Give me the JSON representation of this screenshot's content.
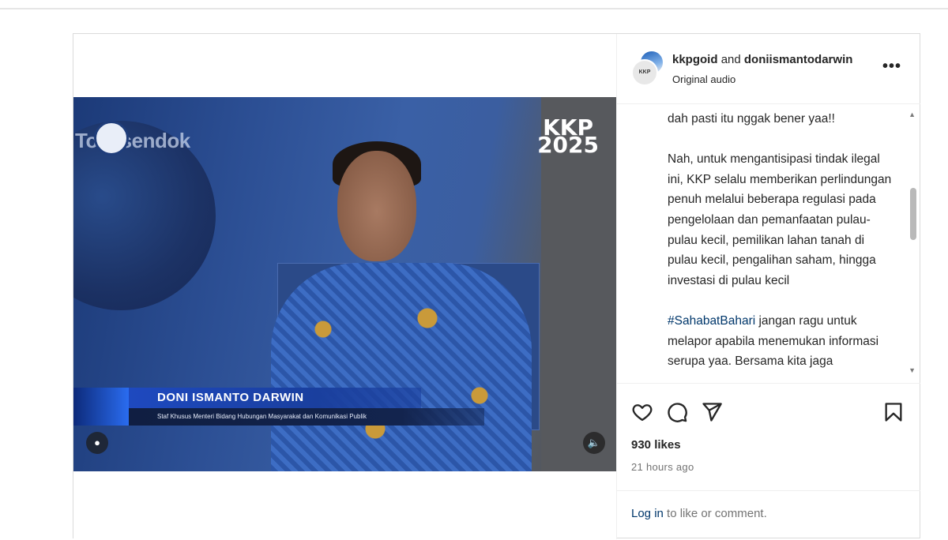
{
  "post": {
    "accounts": {
      "primary": "kkpgoid",
      "connector": "and",
      "secondary": "doniismantodarwin",
      "avatar_text": "KKP"
    },
    "audio_label": "Original audio",
    "more_label": "•••",
    "video": {
      "brand_text": "Tol gsendok",
      "logo_text_line1": "KKP",
      "logo_text_line2": "2025",
      "lower_third_name": "DONI ISMANTO DARWIN",
      "lower_third_title": "Staf Khusus Menteri Bidang Hubungan Masyarakat dan Komunikasi Publik"
    },
    "caption": {
      "line_top": "dah pasti itu nggak bener yaa!!",
      "paragraph2": "Nah, untuk mengantisipasi tindak ilegal ini, KKP selalu memberikan perlindungan penuh melalui beberapa regulasi pada pengelolaan dan pemanfaatan pulau-pulau kecil, pemilikan lahan tanah di pulau kecil, pengalihan saham, hingga investasi di pulau kecil",
      "hashtag": "#SahabatBahari",
      "paragraph3_rest": " jangan ragu untuk melapor apabila menemukan informasi serupa yaa. Bersama kita jaga"
    },
    "likes": "930 likes",
    "time_ago": "21 hours ago",
    "login": {
      "link": "Log in",
      "rest": " to like or comment."
    }
  }
}
